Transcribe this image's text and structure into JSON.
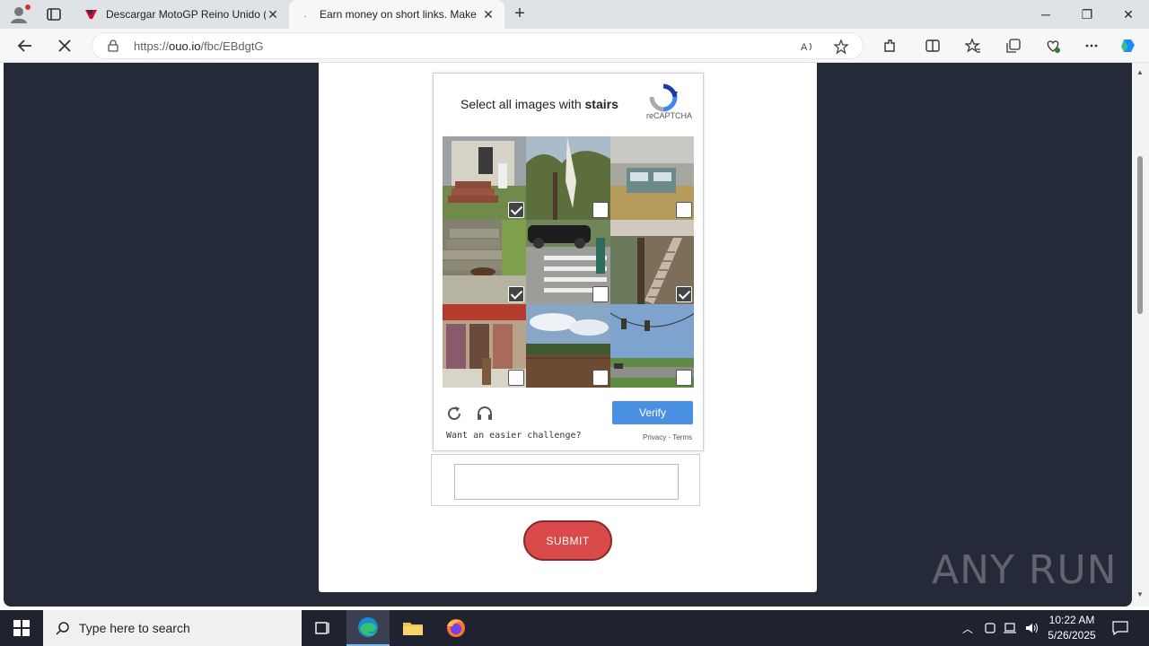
{
  "browser": {
    "tabs": [
      {
        "title": "Descargar MotoGP Reino Unido (",
        "active": false
      },
      {
        "title": "Earn money on short links. Make",
        "active": true
      }
    ],
    "url_prefix": "https://",
    "url_domain": "ouo.io",
    "url_path": "/fbc/EBdgtG"
  },
  "captcha": {
    "prompt_text": "Select all images with",
    "prompt_target": "stairs",
    "brand": "reCAPTCHA",
    "tiles": [
      {
        "checked": true
      },
      {
        "checked": false
      },
      {
        "checked": false
      },
      {
        "checked": true
      },
      {
        "checked": false
      },
      {
        "checked": true
      },
      {
        "checked": false
      },
      {
        "checked": false
      },
      {
        "checked": false
      }
    ],
    "verify_label": "Verify",
    "easier_label": "Want an easier challenge?",
    "privacy_label": "Privacy - Terms"
  },
  "form": {
    "submit_label": "SUBMIT",
    "answer_value": ""
  },
  "watermark": "ANY RUN",
  "taskbar": {
    "search_placeholder": "Type here to search",
    "time": "10:22 AM",
    "date": "5/26/2025"
  },
  "colors": {
    "page_bg": "#242a37",
    "verify": "#4a90e2",
    "submit": "#d94a4a"
  }
}
